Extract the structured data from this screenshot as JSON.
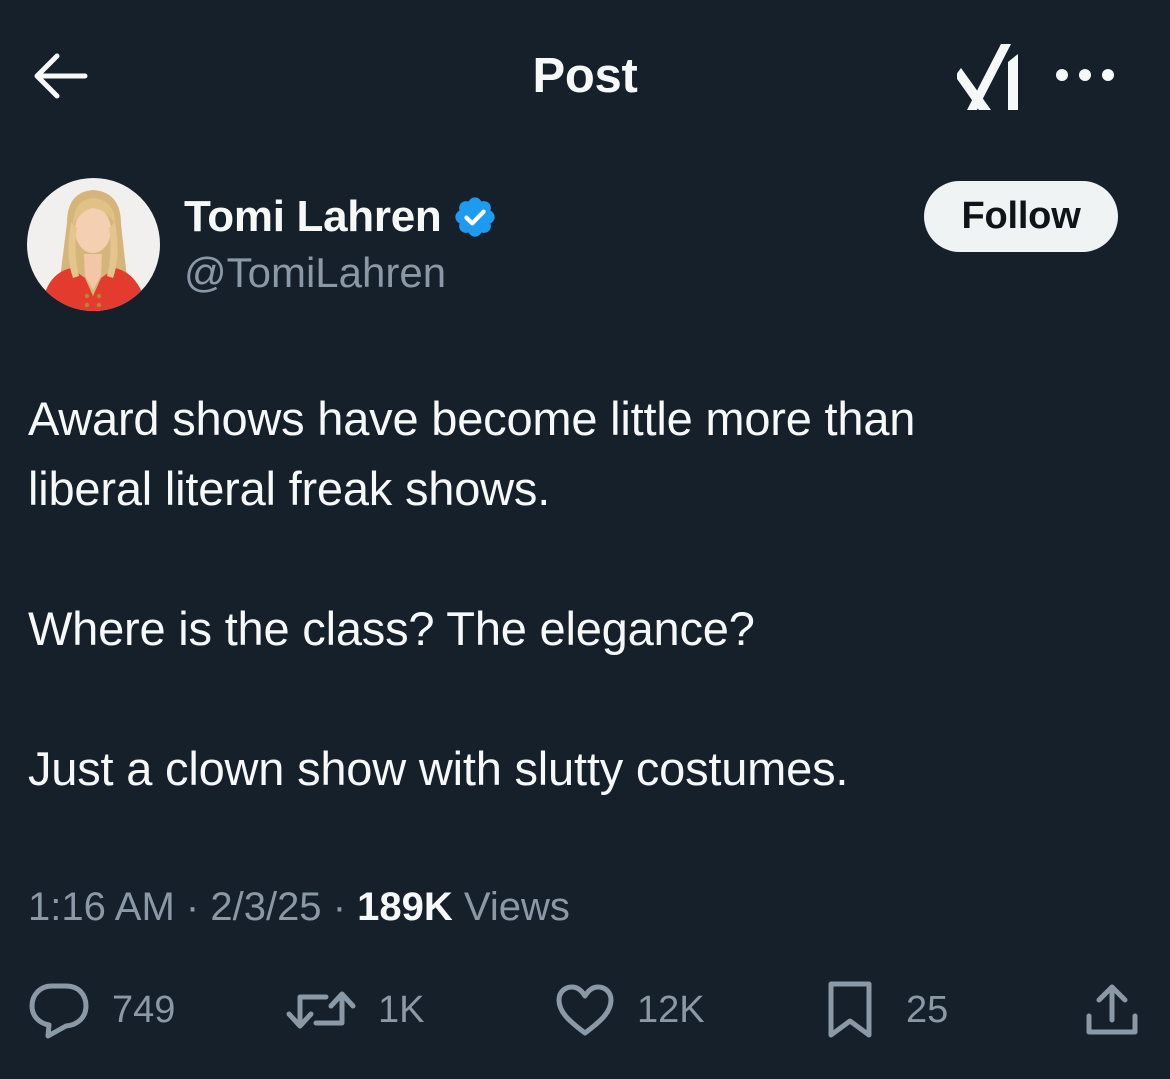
{
  "header": {
    "title": "Post",
    "icons": {
      "back": "arrow-left-icon",
      "grok": "grok-icon",
      "more": "more-horizontal-icon"
    }
  },
  "author": {
    "name": "Tomi Lahren",
    "handle": "@TomiLahren",
    "verified": true,
    "avatar": "avatar-image",
    "follow_label": "Follow"
  },
  "tweet": {
    "lines": [
      "Award shows have become little more than",
      "liberal literal freak shows.",
      "Where is the class? The elegance?",
      "Just a clown show with slutty costumes."
    ]
  },
  "meta": {
    "time": "1:16 AM",
    "sep1": "·",
    "date": "2/3/25",
    "sep2": "·",
    "views_count": "189K",
    "views_label": "Views"
  },
  "actions": {
    "reply": {
      "icon": "reply-icon",
      "count": "749"
    },
    "repost": {
      "icon": "repost-icon",
      "count": "1K"
    },
    "like": {
      "icon": "heart-icon",
      "count": "12K"
    },
    "bookmark": {
      "icon": "bookmark-icon",
      "count": "25"
    },
    "share": {
      "icon": "share-icon"
    }
  },
  "colors": {
    "background": "#15202b",
    "primary_text": "#f7f9f9",
    "secondary_text": "#8b98a5",
    "verified_blue": "#1d9bf0",
    "follow_bg": "#eff3f4"
  }
}
